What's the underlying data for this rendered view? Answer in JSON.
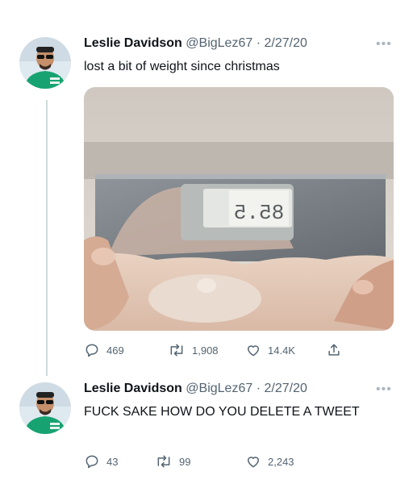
{
  "tweets": [
    {
      "name": "Leslie Davidson",
      "handle": "@BigLez67",
      "separator": "·",
      "date": "2/27/20",
      "text": "lost a bit of weight since christmas",
      "has_media": true,
      "scale_reading": "85.5",
      "actions": {
        "replies": "469",
        "retweets": "1,908",
        "likes": "14.4K"
      }
    },
    {
      "name": "Leslie Davidson",
      "handle": "@BigLez67",
      "separator": "·",
      "date": "2/27/20",
      "text": "FUCK SAKE HOW DO YOU DELETE A TWEET",
      "has_media": false,
      "actions": {
        "replies": "43",
        "retweets": "99",
        "likes": "2,243"
      }
    }
  ],
  "colors": {
    "muted": "#536471",
    "thread_line": "#cfd9de"
  },
  "icons": [
    "reply-icon",
    "retweet-icon",
    "like-icon",
    "share-icon",
    "more-icon"
  ]
}
